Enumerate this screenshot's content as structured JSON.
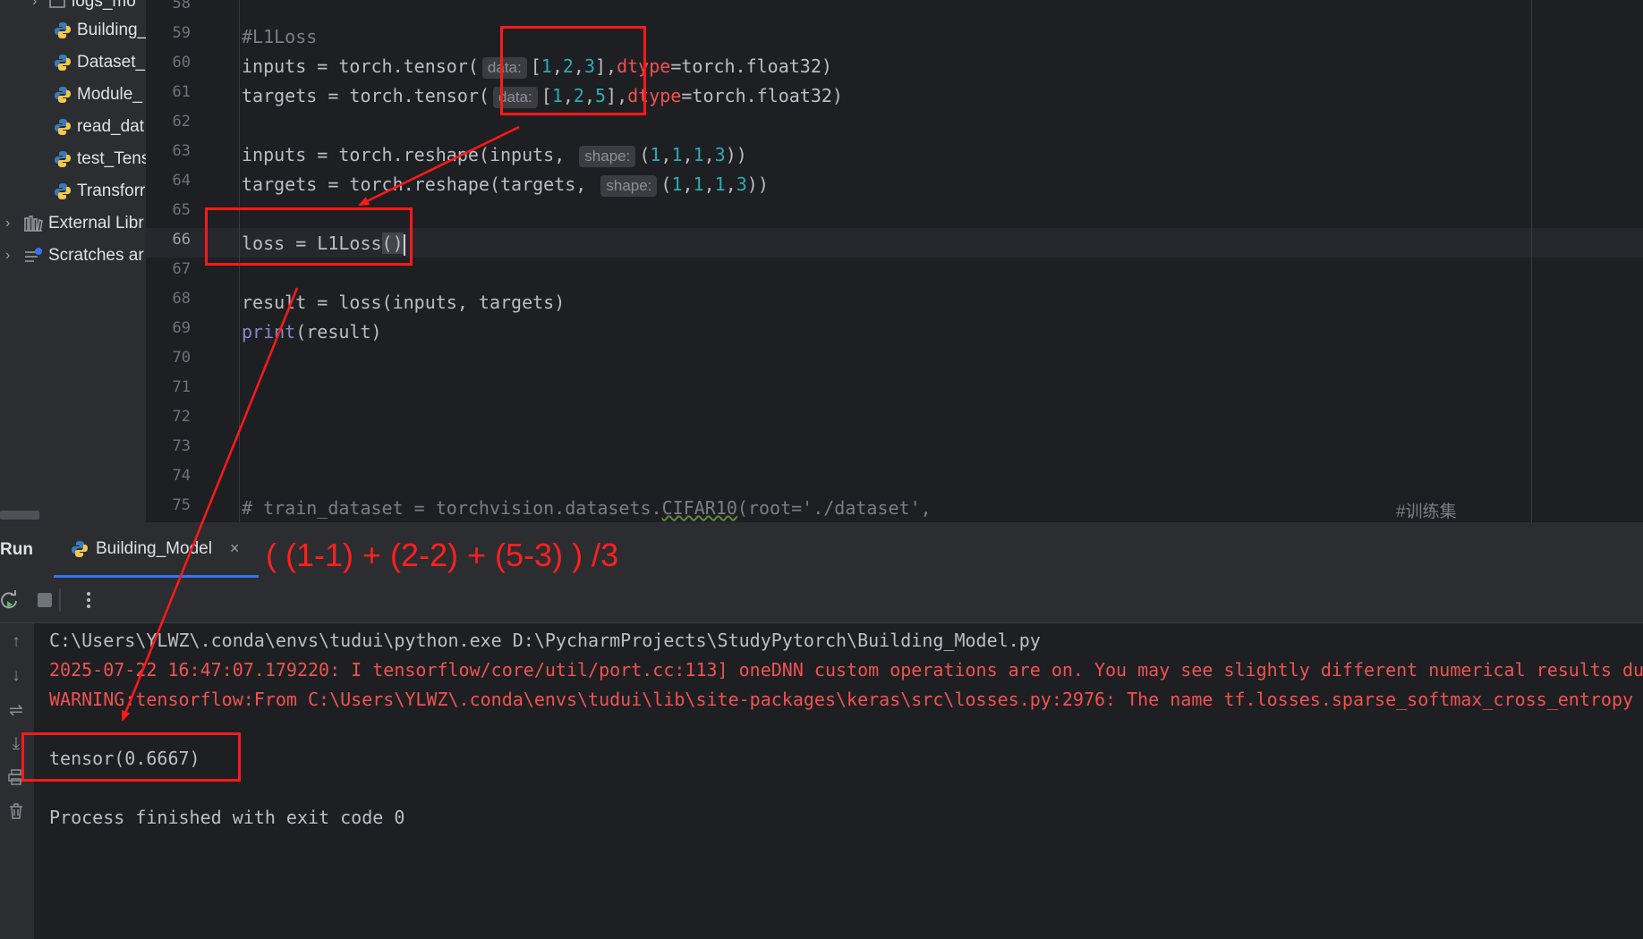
{
  "project_tree": {
    "items": [
      {
        "label": "logs_mo",
        "kind": "folder"
      },
      {
        "label": "Building_",
        "kind": "python"
      },
      {
        "label": "Dataset_",
        "kind": "python"
      },
      {
        "label": "Module_",
        "kind": "python"
      },
      {
        "label": "read_dat",
        "kind": "python"
      },
      {
        "label": "test_Tens",
        "kind": "python"
      },
      {
        "label": "Transforr",
        "kind": "python"
      },
      {
        "label": "External Libr",
        "kind": "library"
      },
      {
        "label": "Scratches ar",
        "kind": "scratches"
      }
    ]
  },
  "editor": {
    "line_numbers": [
      "58",
      "59",
      "60",
      "61",
      "62",
      "63",
      "64",
      "65",
      "66",
      "67",
      "68",
      "69",
      "70",
      "71",
      "72",
      "73",
      "74",
      "75"
    ],
    "current_line": "66",
    "code": {
      "l59": "#L1Loss",
      "l60_a": "inputs = torch.tensor(",
      "l60_hint": "data:",
      "l60_b": "[",
      "l60_n1": "1",
      "l60_n2": "2",
      "l60_n3": "3",
      "l60_c": "],",
      "l60_kw": "dtype",
      "l60_d": "=torch.float32)",
      "l61_a": "targets = torch.tensor(",
      "l61_hint": "data:",
      "l61_n1": "1",
      "l61_n2": "2",
      "l61_n3": "5",
      "l61_kw": "dtype",
      "l61_d": "=torch.float32)",
      "l63_a": "inputs = torch.reshape(inputs,",
      "l63_hint": "shape:",
      "l64_a": "targets = torch.reshape(targets,",
      "l64_hint": "shape:",
      "shape_nums": [
        "1",
        "1",
        "1",
        "3"
      ],
      "l66_a": "loss = L1Loss",
      "l66_b": "()",
      "l68": "result = loss(inputs, targets)",
      "l69_fn": "print",
      "l69_b": "(result)",
      "l75_a": "# train_dataset = torchvision.datasets.",
      "l75_b": "CIFAR10",
      "l75_c": "(root='./dataset',",
      "l75_cn": "#训练集"
    }
  },
  "run_panel": {
    "title": "Run",
    "tab_label": "Building_Model",
    "tab_close": "×",
    "output": [
      {
        "text": "C:\\Users\\YLWZ\\.conda\\envs\\tudui\\python.exe D:\\PycharmProjects\\StudyPytorch\\Building_Model.py",
        "type": "normal"
      },
      {
        "text": "2025-07-22 16:47:07.179220: I tensorflow/core/util/port.cc:113] oneDNN custom operations are on. You may see slightly different numerical results due",
        "type": "err"
      },
      {
        "text": "WARNING:tensorflow:From C:\\Users\\YLWZ\\.conda\\envs\\tudui\\lib\\site-packages\\keras\\src\\losses.py:2976: The name tf.losses.sparse_softmax_cross_entropy i",
        "type": "err"
      },
      {
        "text": "",
        "type": "normal"
      },
      {
        "text": "tensor(0.6667)",
        "type": "normal"
      },
      {
        "text": "",
        "type": "normal"
      },
      {
        "text": "Process finished with exit code 0",
        "type": "normal"
      }
    ]
  },
  "annotation": {
    "formula": "( (1-1) + (2-2) + (5-3) ) /3",
    "color": "#ff1a1a"
  },
  "colors": {
    "background": "#1e1f22",
    "panel": "#2b2d30",
    "number": "#2aacb8",
    "keyword_param": "#ef5350",
    "error_text": "#ef5350"
  }
}
